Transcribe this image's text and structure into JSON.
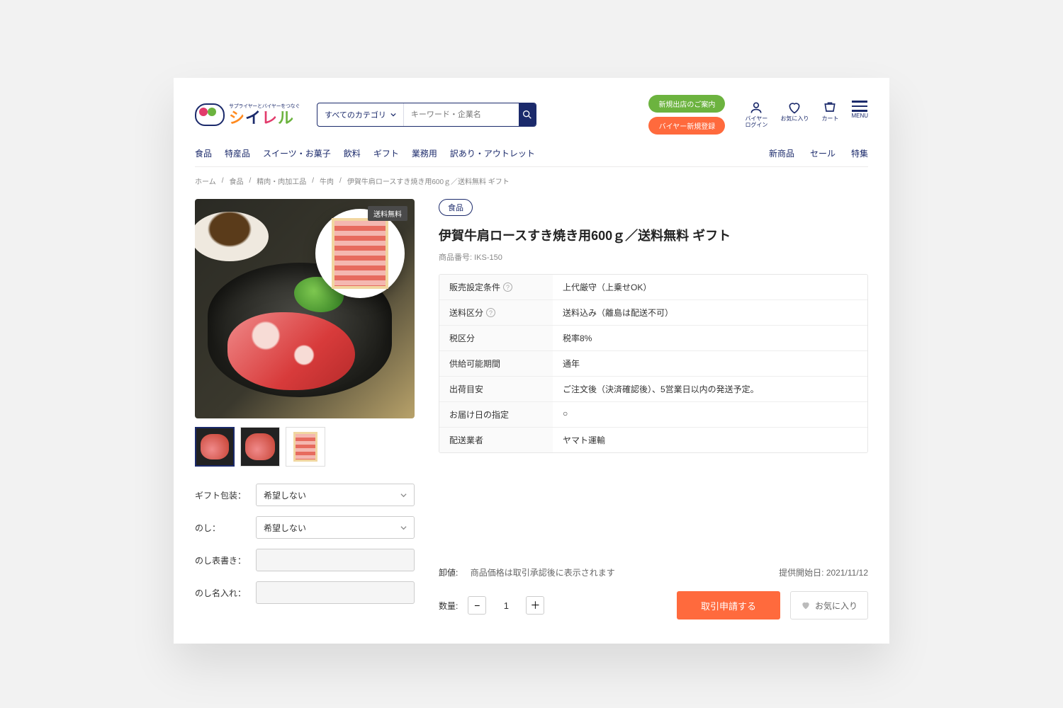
{
  "logo": {
    "tagline": "サプライヤーとバイヤーをつなぐ",
    "name": "シイレル"
  },
  "search": {
    "category": "すべてのカテゴリ",
    "placeholder": "キーワード・企業名"
  },
  "cta": {
    "new_store": "新規出店のご案内",
    "buyer_register": "バイヤー新規登録"
  },
  "header_icons": {
    "login": "バイヤー\nログイン",
    "favorite": "お気に入り",
    "cart": "カート",
    "menu": "MENU"
  },
  "nav": {
    "items": [
      "食品",
      "特産品",
      "スイーツ・お菓子",
      "飲料",
      "ギフト",
      "業務用",
      "訳あり・アウトレット"
    ],
    "right": [
      "新商品",
      "セール",
      "特集"
    ]
  },
  "breadcrumb": [
    "ホーム",
    "食品",
    "精肉・肉加工品",
    "牛肉",
    "伊賀牛肩ロースすき焼き用600ｇ／送料無料 ギフト"
  ],
  "product": {
    "badge_ship": "送料無料",
    "category_chip": "食品",
    "title": "伊賀牛肩ロースすき焼き用600ｇ／送料無料 ギフト",
    "number_label": "商品番号:",
    "number_value": "IKS-150",
    "specs": [
      {
        "k": "販売設定条件",
        "q": true,
        "v": "上代厳守（上乗せOK）"
      },
      {
        "k": "送料区分",
        "q": true,
        "v": "送料込み（離島は配送不可）"
      },
      {
        "k": "税区分",
        "q": false,
        "v": "税率8%"
      },
      {
        "k": "供給可能期間",
        "q": false,
        "v": "通年"
      },
      {
        "k": "出荷目安",
        "q": false,
        "v": "ご注文後（決済確認後）、5営業日以内の発送予定。"
      },
      {
        "k": "お届け日の指定",
        "q": false,
        "v": "○"
      },
      {
        "k": "配送業者",
        "q": false,
        "v": "ヤマト運輸"
      }
    ]
  },
  "options": {
    "gift_wrap_label": "ギフト包装：",
    "gift_wrap_value": "希望しない",
    "noshi_label": "のし：",
    "noshi_value": "希望しない",
    "noshi_text_label": "のし表書き：",
    "noshi_name_label": "のし名入れ："
  },
  "pricing": {
    "label": "卸値:",
    "note": "商品価格は取引承認後に表示されます",
    "start_label": "提供開始日:",
    "start_value": "2021/11/12"
  },
  "actions": {
    "qty_label": "数量:",
    "qty_value": "1",
    "apply": "取引申請する",
    "favorite": "お気に入り"
  }
}
